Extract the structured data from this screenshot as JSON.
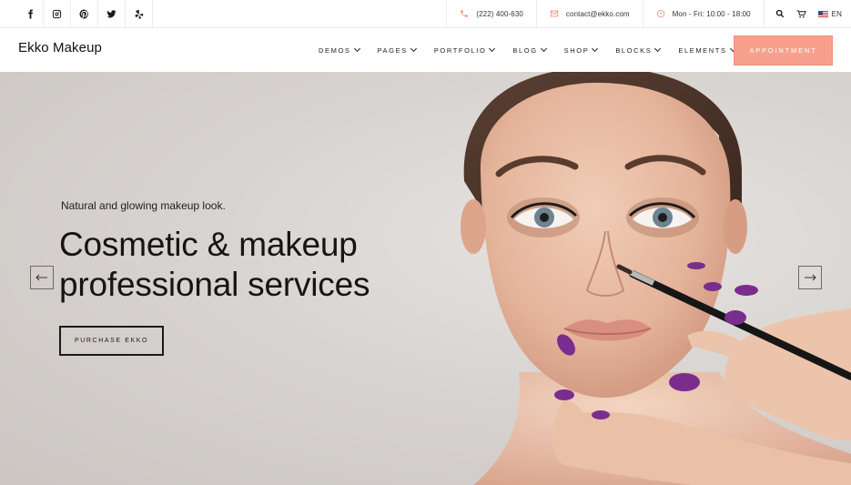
{
  "topbar": {
    "social": [
      "facebook-icon",
      "instagram-icon",
      "pinterest-icon",
      "twitter-icon",
      "yelp-icon"
    ],
    "phone": "(222) 400-630",
    "email": "contact@ekko.com",
    "hours": "Mon - Fri: 10:00 - 18:00",
    "language": "EN"
  },
  "nav": {
    "brand": "Ekko Makeup",
    "items": [
      "DEMOS",
      "PAGES",
      "PORTFOLIO",
      "BLOG",
      "SHOP",
      "BLOCKS",
      "ELEMENTS"
    ],
    "cta": "APPOINTMENT"
  },
  "hero": {
    "subtitle": "Natural and glowing makeup look.",
    "title": "Cosmetic & makeup professional services",
    "button": "PURCHASE EKKO"
  },
  "colors": {
    "accent": "#f6a08d",
    "text": "#151515",
    "hero_bg": "#d8d4d1",
    "nail": "#7b2d8e"
  }
}
